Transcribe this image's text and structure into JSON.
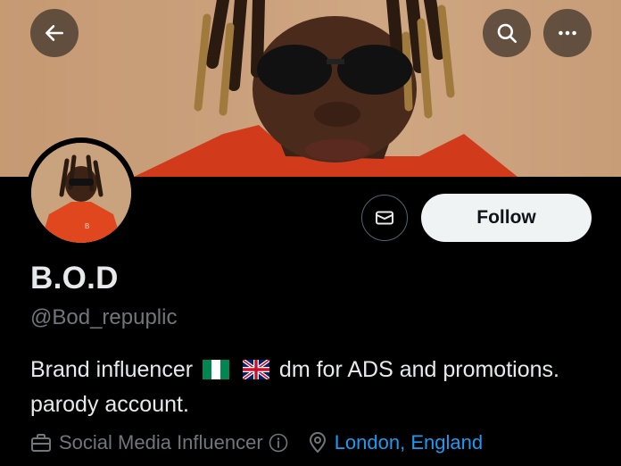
{
  "header": {
    "back_icon": "arrow-left-icon",
    "search_icon": "search-icon",
    "more_icon": "more-horizontal-icon"
  },
  "profile": {
    "display_name": "B.O.D",
    "handle": "@Bod_repuplic",
    "bio_part1": "Brand influencer",
    "bio_flag1": "nigeria-flag",
    "bio_flag2": "uk-flag",
    "bio_part2": "dm for ADS and promotions. parody account.",
    "category": "Social Media Influencer",
    "location": "London, England"
  },
  "actions": {
    "message_icon": "envelope-icon",
    "follow_label": "Follow"
  },
  "colors": {
    "background": "#000000",
    "text_primary": "#e7e9ea",
    "text_secondary": "#71767b",
    "link": "#1d9bf0",
    "follow_bg": "#eff3f4"
  }
}
